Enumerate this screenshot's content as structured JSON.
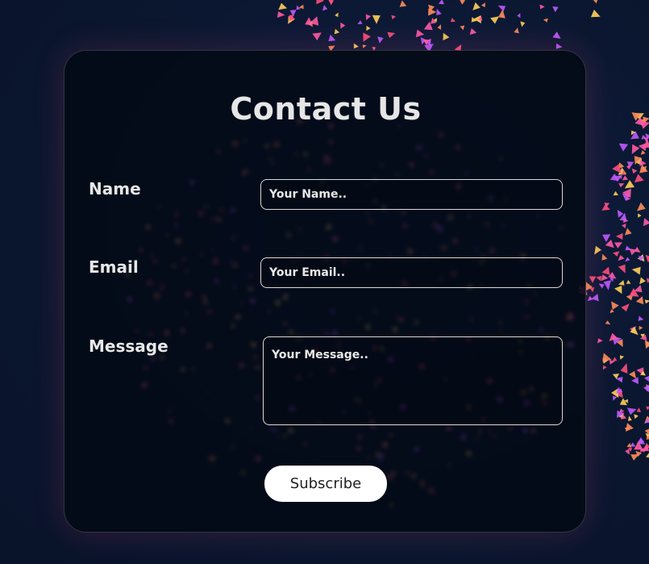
{
  "form": {
    "title": "Contact Us",
    "name_label": "Name",
    "name_placeholder": "Your Name..",
    "email_label": "Email",
    "email_placeholder": "Your Email..",
    "message_label": "Message",
    "message_placeholder": "Your Message..",
    "submit_label": "Subscribe"
  },
  "colors": {
    "background": "#0b1730",
    "card_background": "#030a16",
    "text": "#e8e8e8",
    "button_background": "#ffffff",
    "confetti": [
      "#ff5aa5",
      "#ff8c5a",
      "#c05aff",
      "#ffcf5a",
      "#ff4f7d"
    ]
  }
}
